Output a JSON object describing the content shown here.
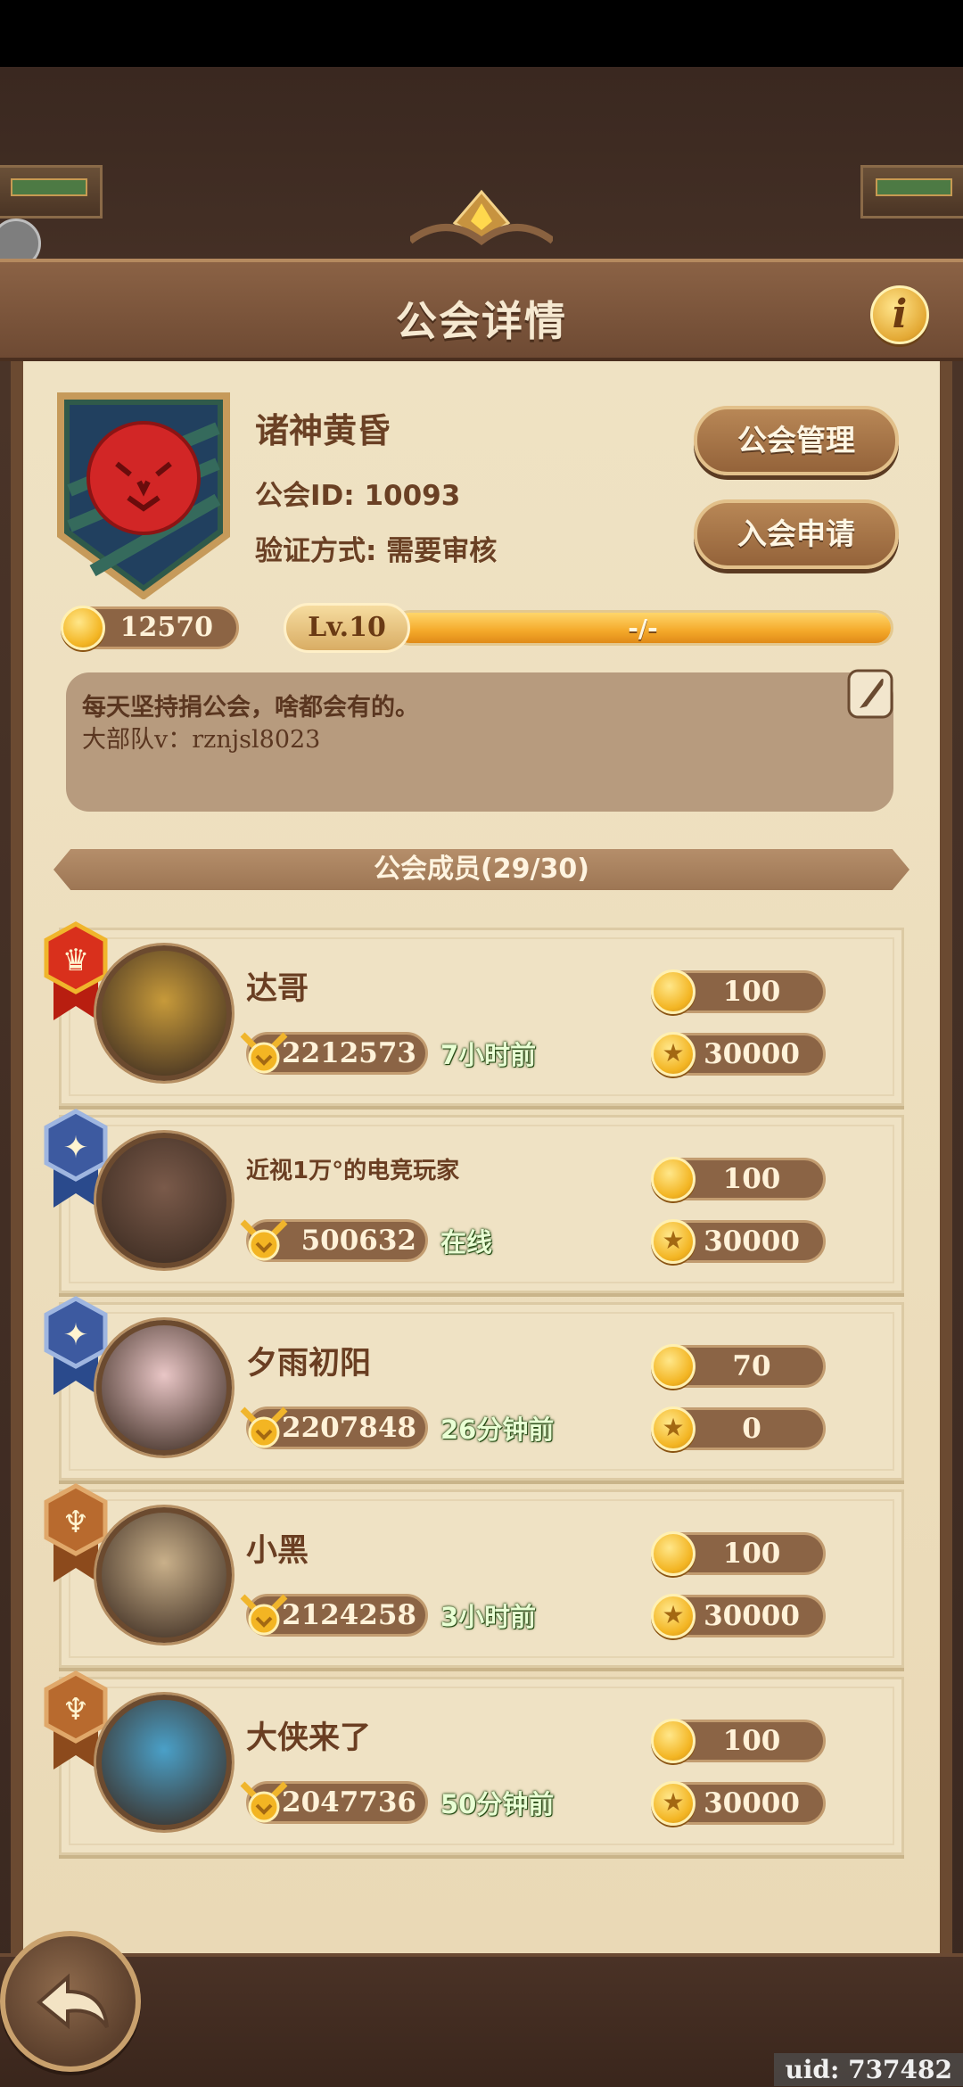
{
  "header": {
    "title": "公会详情",
    "info_label": "i"
  },
  "guild": {
    "name": "诸神黄昏",
    "id_text": "公会ID: 10093",
    "verify_text": "验证方式: 需要审核",
    "coins": "12570",
    "level": "Lv.10",
    "level_progress_text": "-/-",
    "level_progress": 1.0,
    "notice_line1": "每天坚持捐公会，啥都会有的。",
    "notice_line2": "大部队v：rznjsl8023",
    "badge_icon": "red-lion-icon"
  },
  "buttons": {
    "manage": "公会管理",
    "apply": "入会申请"
  },
  "members_title": "公会成员(29/30)",
  "members": [
    {
      "name": "达哥",
      "power": "2212573",
      "last_seen": "7小时前",
      "contribution": "100",
      "medals": "30000",
      "rank": "leader",
      "name_size": "normal"
    },
    {
      "name": "近视1万°的电竞玩家",
      "power": "500632",
      "last_seen": "在线",
      "contribution": "100",
      "medals": "30000",
      "rank": "elder",
      "name_size": "small"
    },
    {
      "name": "夕雨初阳",
      "power": "2207848",
      "last_seen": "26分钟前",
      "contribution": "70",
      "medals": "0",
      "rank": "elder",
      "name_size": "normal"
    },
    {
      "name": "小黑",
      "power": "2124258",
      "last_seen": "3小时前",
      "contribution": "100",
      "medals": "30000",
      "rank": "member",
      "name_size": "normal"
    },
    {
      "name": "大侠来了",
      "power": "2047736",
      "last_seen": "50分钟前",
      "contribution": "100",
      "medals": "30000",
      "rank": "member",
      "name_size": "normal"
    }
  ],
  "footer": {
    "uid": "uid: 737482"
  },
  "colors": {
    "parchment": "#efe2c3",
    "wood": "#6b4a31",
    "gold": "#f3b523",
    "online_green": "#e9ffd4"
  }
}
